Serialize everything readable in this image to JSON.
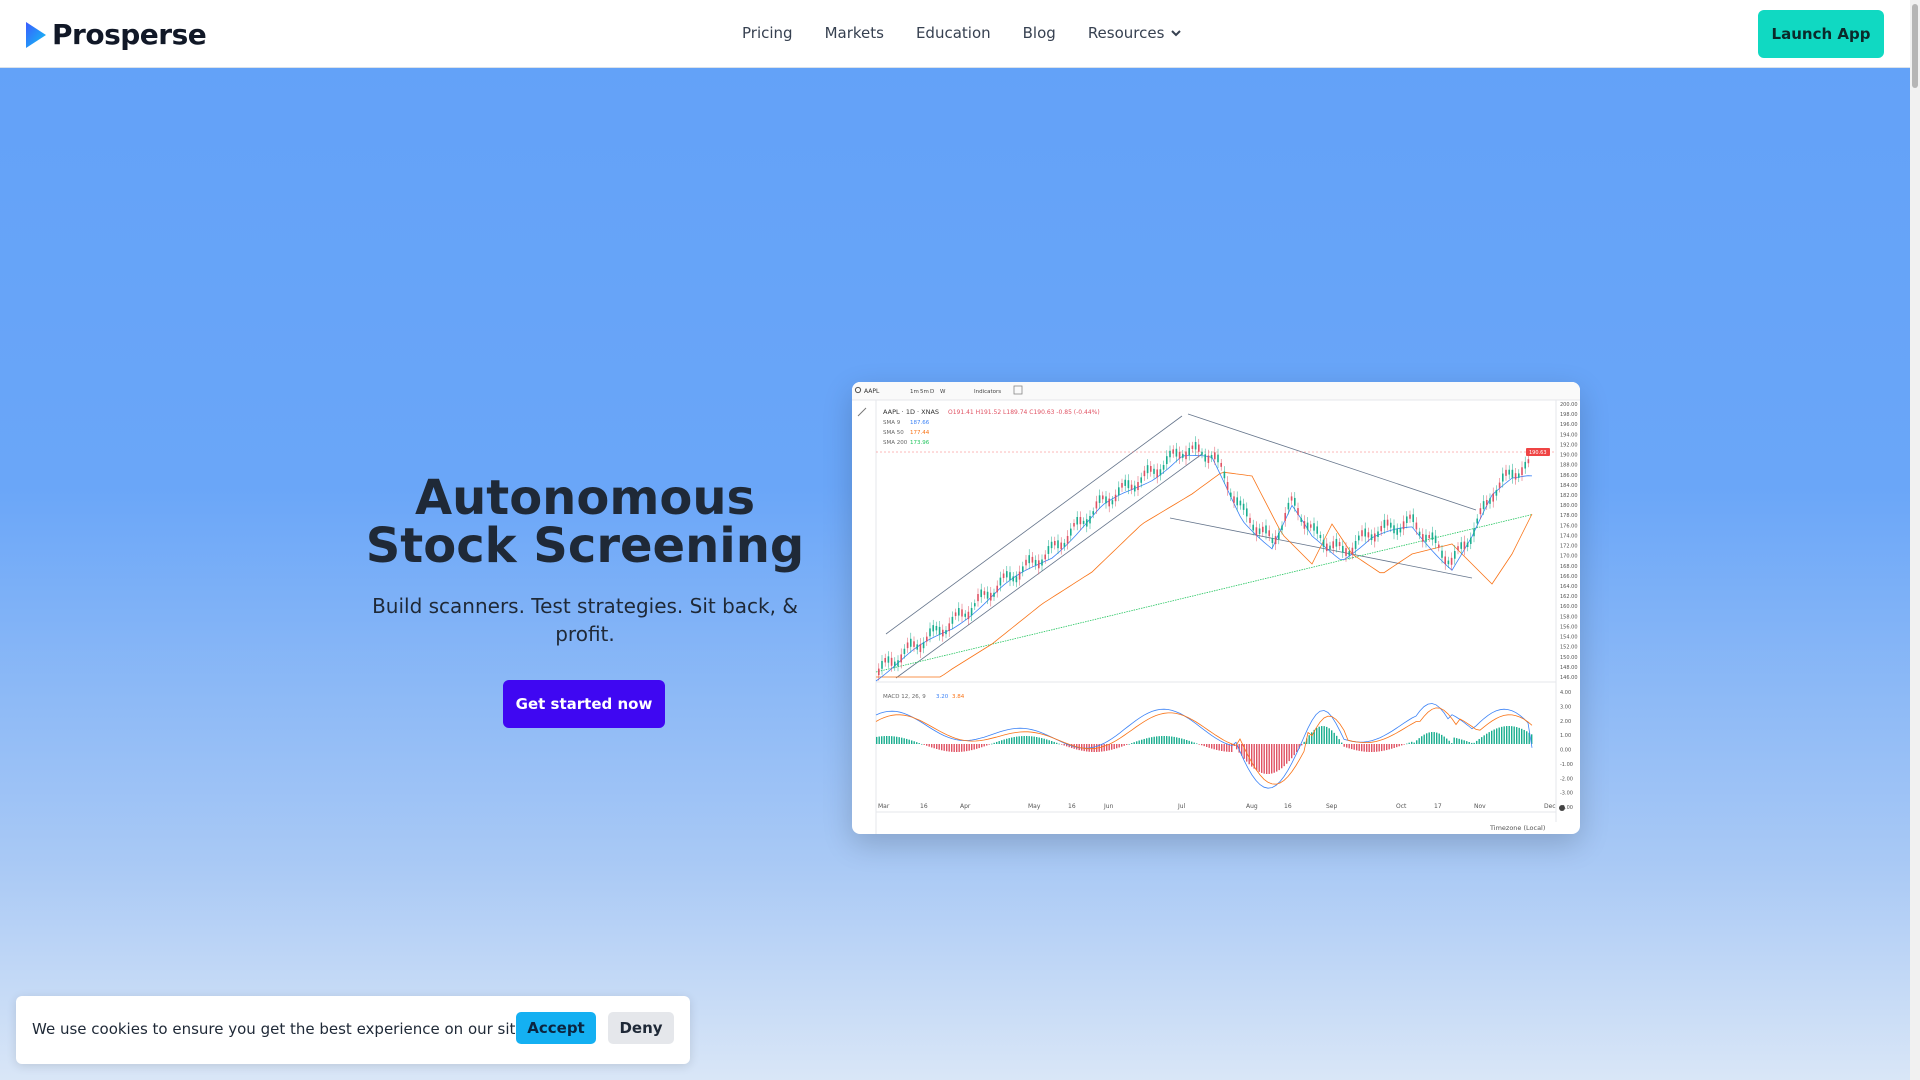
{
  "brand": {
    "name": "Prosperse",
    "logo_icon": "play-triangle-logo",
    "accent": "#10d9c2"
  },
  "nav": {
    "links": [
      "Pricing",
      "Markets",
      "Education",
      "Blog",
      "Resources"
    ],
    "resources_icon": "chevron-down-icon",
    "launch_label": "Launch App"
  },
  "hero": {
    "title_line1": "Autonomous",
    "title_line2": "Stock Screening",
    "subtitle": "Build scanners. Test strategies. Sit back, & profit.",
    "cta_label": "Get started now",
    "cta_color": "#3f07f2"
  },
  "chart_preview": {
    "symbol": "AAPL",
    "toolbar": [
      "1m",
      "5m",
      "D",
      "W",
      "Indicators"
    ],
    "header": "AAPL · 1D · XNAS",
    "ohlc": "O191.41 H191.52 L189.74 C190.63 -0.85 (-0.44%)",
    "sma": [
      {
        "label": "SMA 9",
        "value": "187.66",
        "color": "#3b82f6"
      },
      {
        "label": "SMA 50",
        "value": "177.44",
        "color": "#f97316"
      },
      {
        "label": "SMA 200",
        "value": "173.96",
        "color": "#22c55e"
      }
    ],
    "macd_label": "MACD 12, 26, 9",
    "macd_vals": [
      "3.20",
      "3.84"
    ],
    "price_tag": "190.63",
    "x_labels": [
      "Mar",
      "16",
      "Apr",
      "May",
      "16",
      "Jun",
      "Jul",
      "Aug",
      "16",
      "Sep",
      "Oct",
      "17",
      "Nov",
      "Dec"
    ],
    "y_labels": [
      "200.00",
      "198.00",
      "196.00",
      "194.00",
      "192.00",
      "190.00",
      "188.00",
      "186.00",
      "184.00",
      "182.00",
      "180.00",
      "178.00",
      "176.00",
      "174.00",
      "172.00",
      "170.00",
      "168.00",
      "166.00",
      "164.00",
      "162.00",
      "160.00",
      "158.00",
      "156.00",
      "154.00",
      "152.00",
      "150.00",
      "148.00",
      "146.00"
    ],
    "macd_y_labels": [
      "4.00",
      "3.00",
      "2.00",
      "1.00",
      "0.00",
      "-1.00",
      "-2.00",
      "-3.00",
      "-4.00"
    ],
    "timezone": "Timezone (Local)"
  },
  "cookie": {
    "text": "We use cookies to ensure you get the best experience on our site.",
    "accept_label": "Accept",
    "deny_label": "Deny"
  }
}
